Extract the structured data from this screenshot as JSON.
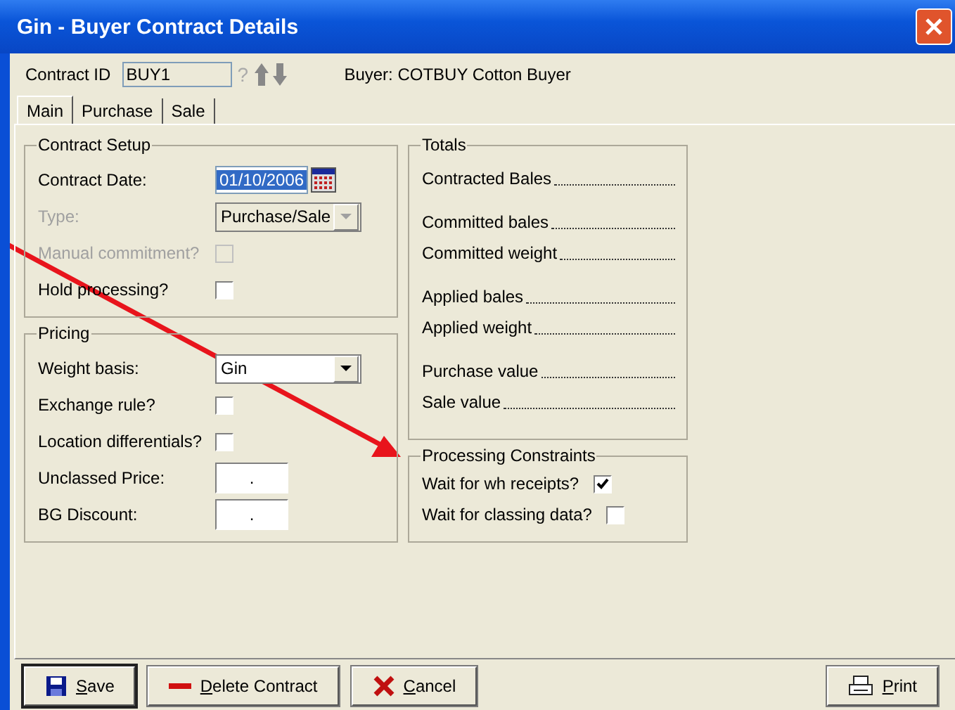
{
  "window": {
    "title": "Gin - Buyer Contract Details"
  },
  "header": {
    "contract_id_label": "Contract ID",
    "contract_id": "BUY1",
    "help_glyph": "?",
    "buyer": "Buyer: COTBUY  Cotton Buyer"
  },
  "tabs": [
    {
      "label": "Main",
      "selected": true
    },
    {
      "label": "Purchase",
      "selected": false
    },
    {
      "label": "Sale",
      "selected": false
    }
  ],
  "contract_setup": {
    "title": "Contract Setup",
    "rows": [
      {
        "kind": "date",
        "label": "Contract Date:",
        "value": "01/10/2006",
        "highlighted": true,
        "disabled": false
      },
      {
        "kind": "select",
        "label": "Type:",
        "value": "Purchase/Sale",
        "disabled": true
      },
      {
        "kind": "checkbox",
        "label": "Manual commitment?",
        "checked": false,
        "disabled": true
      },
      {
        "kind": "checkbox",
        "label": "Hold processing?",
        "checked": false,
        "disabled": false
      }
    ]
  },
  "pricing": {
    "title": "Pricing",
    "rows": [
      {
        "kind": "select",
        "label": "Weight basis:",
        "value": "Gin",
        "disabled": false
      },
      {
        "kind": "checkbox",
        "label": "Exchange rule?",
        "checked": false,
        "disabled": false
      },
      {
        "kind": "checkbox",
        "label": "Location differentials?",
        "checked": false,
        "disabled": false
      },
      {
        "kind": "text",
        "label": "Unclassed Price:",
        "value": ".",
        "disabled": false
      },
      {
        "kind": "text",
        "label": "BG Discount:",
        "value": ".",
        "disabled": false
      }
    ]
  },
  "totals": {
    "title": "Totals",
    "groups": [
      {
        "items": [
          {
            "label": "Contracted Bales"
          }
        ]
      },
      {
        "items": [
          {
            "label": "Committed bales"
          },
          {
            "label": "Committed weight"
          }
        ]
      },
      {
        "items": [
          {
            "label": "Applied bales"
          },
          {
            "label": "Applied weight"
          }
        ]
      },
      {
        "items": [
          {
            "label": "Purchase value"
          },
          {
            "label": "Sale value"
          }
        ]
      }
    ]
  },
  "processing": {
    "title": "Processing Constraints",
    "rows": [
      {
        "kind": "checkbox",
        "label": "Wait for wh receipts?",
        "checked": true,
        "disabled": false
      },
      {
        "kind": "checkbox",
        "label": "Wait for classing data?",
        "checked": false,
        "disabled": false
      }
    ]
  },
  "buttons": [
    {
      "kind": "save",
      "label": "Save"
    },
    {
      "kind": "delete",
      "label": "Delete Contract"
    },
    {
      "kind": "cancel",
      "label": "Cancel"
    },
    {
      "kind": "print",
      "label": "Print"
    }
  ]
}
